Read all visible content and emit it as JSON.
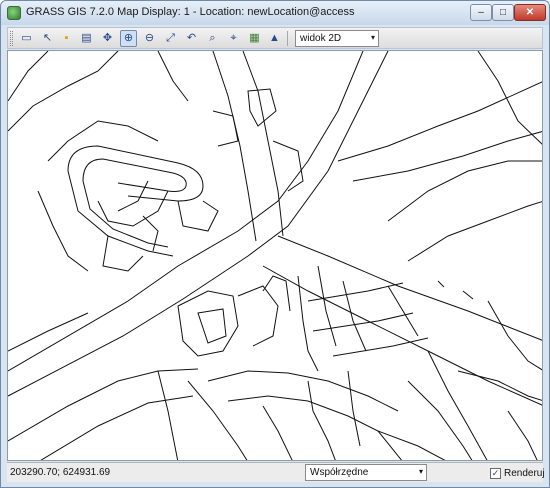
{
  "window": {
    "title": "GRASS GIS 7.2.0 Map Display: 1 - Location: newLocation@access",
    "minimize_glyph": "–",
    "maximize_glyph": "□",
    "close_glyph": "✕"
  },
  "toolbar": {
    "tools": [
      {
        "name": "display-map-icon",
        "glyph": "▭"
      },
      {
        "name": "pointer-icon",
        "glyph": "↖"
      },
      {
        "name": "query-icon",
        "glyph": "▪"
      },
      {
        "name": "erase-icon",
        "glyph": "▤"
      },
      {
        "name": "pan-icon",
        "glyph": "✥"
      },
      {
        "name": "zoom-in-icon",
        "glyph": "⊕"
      },
      {
        "name": "zoom-out-icon",
        "glyph": "⊖"
      },
      {
        "name": "zoom-extent-icon",
        "glyph": "⤢"
      },
      {
        "name": "zoom-back-icon",
        "glyph": "↶"
      },
      {
        "name": "zoom-options-icon",
        "glyph": "⌕"
      },
      {
        "name": "analyze-icon",
        "glyph": "⌖"
      },
      {
        "name": "overlay-icon",
        "glyph": "▦"
      },
      {
        "name": "decoration-icon",
        "glyph": "▲"
      },
      {
        "name": "save-display-icon",
        "glyph": "▣"
      }
    ],
    "view_mode": "widok 2D",
    "dropdown_glyph": "▾"
  },
  "statusbar": {
    "coordinates": "203290.70; 624931.69",
    "display_mode": "Współrzędne",
    "dropdown_glyph": "▾",
    "render_label": "Renderuj",
    "render_checked": true,
    "check_glyph": "✓"
  }
}
